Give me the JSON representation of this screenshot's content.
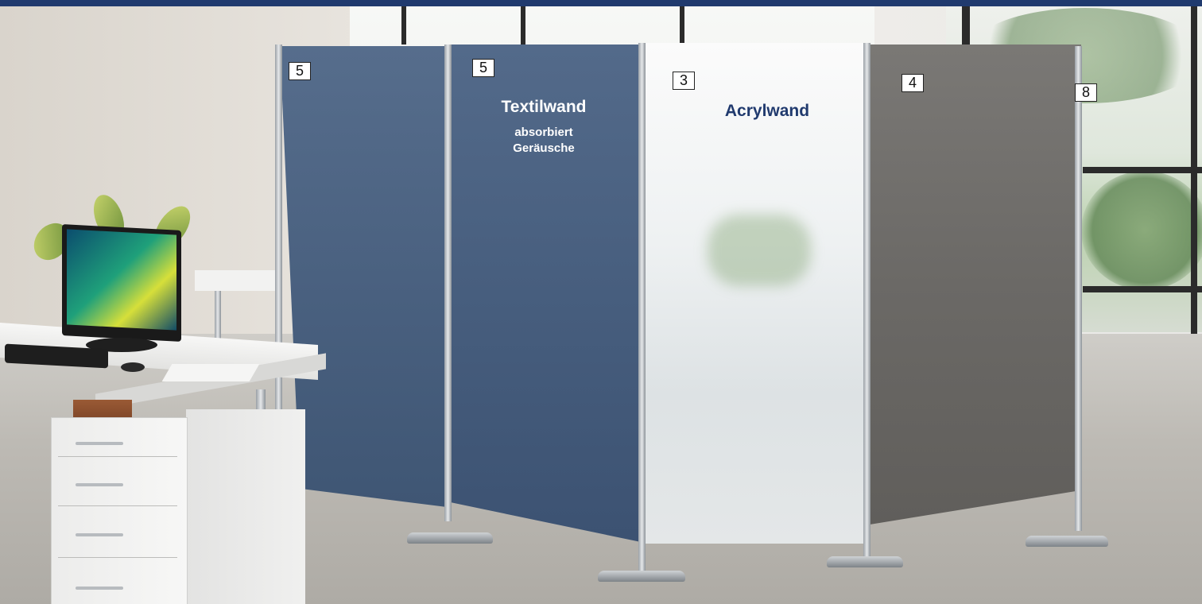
{
  "labels": {
    "marker_1": "5",
    "marker_2": "5",
    "marker_3": "3",
    "marker_4": "4",
    "marker_5": "8"
  },
  "textilwand": {
    "title": "Textilwand",
    "line_1": "absorbiert",
    "line_2": "Geräusche"
  },
  "acrylwand": {
    "title": "Acrylwand"
  },
  "colors": {
    "header_bar": "#203a6e",
    "acryl_text": "#203a6e",
    "blue_panel": "#4a6180",
    "grey_panel": "#6b6966"
  }
}
